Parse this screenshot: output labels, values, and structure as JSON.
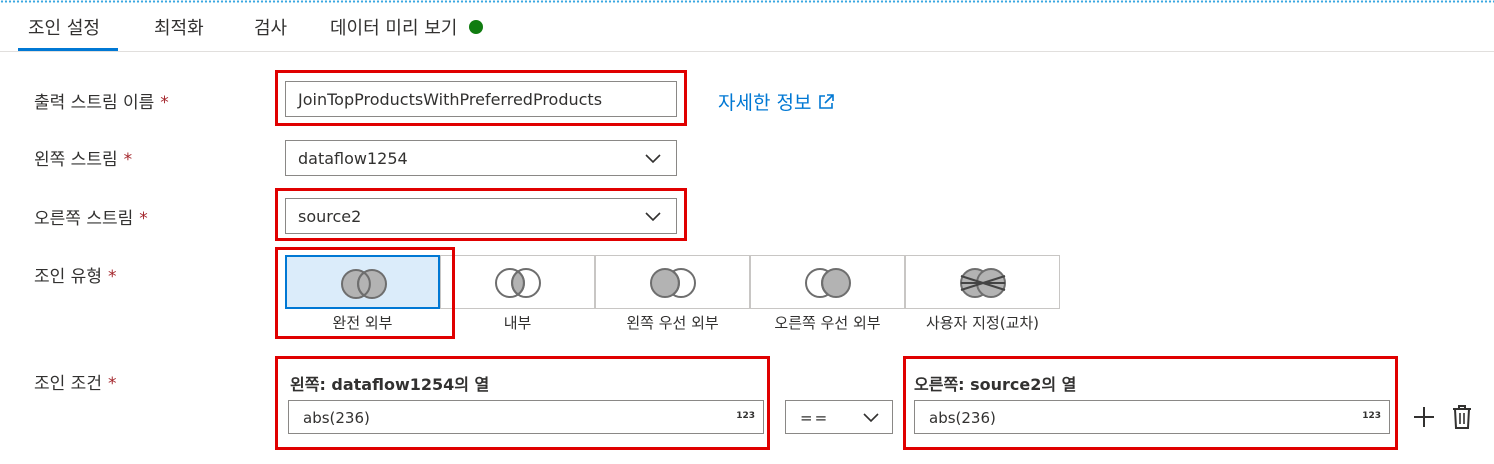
{
  "tabs": [
    {
      "label": "조인 설정",
      "active": true
    },
    {
      "label": "최적화"
    },
    {
      "label": "검사"
    },
    {
      "label": "데이터 미리 보기"
    }
  ],
  "colors": {
    "accent": "#0078d4",
    "status_ok": "#107c10",
    "highlight": "#e00000",
    "required": "#a4262c"
  },
  "form": {
    "required_mark": "*",
    "output_stream": {
      "label": "출력 스트림 이름",
      "value": "JoinTopProductsWithPreferredProducts"
    },
    "learn_more": {
      "label": "자세한 정보",
      "icon": "external-link-icon"
    },
    "left_stream": {
      "label": "왼쪽 스트림",
      "value": "dataflow1254"
    },
    "right_stream": {
      "label": "오른쪽 스트림",
      "value": "source2"
    },
    "join_type": {
      "label": "조인 유형",
      "options": [
        {
          "label": "완전 외부",
          "icon": "full-outer-join-icon",
          "selected": true
        },
        {
          "label": "내부",
          "icon": "inner-join-icon"
        },
        {
          "label": "왼쪽 우선 외부",
          "icon": "left-outer-join-icon"
        },
        {
          "label": "오른쪽 우선 외부",
          "icon": "right-outer-join-icon"
        },
        {
          "label": "사용자 지정(교차)",
          "icon": "custom-cross-join-icon"
        }
      ]
    },
    "join_condition": {
      "label": "조인 조건",
      "left_title": "왼쪽: dataflow1254의 열",
      "left_value": "abs(236)",
      "left_type": "123",
      "operator": "==",
      "right_title": "오른쪽: source2의 열",
      "right_value": "abs(236)",
      "right_type": "123"
    }
  }
}
